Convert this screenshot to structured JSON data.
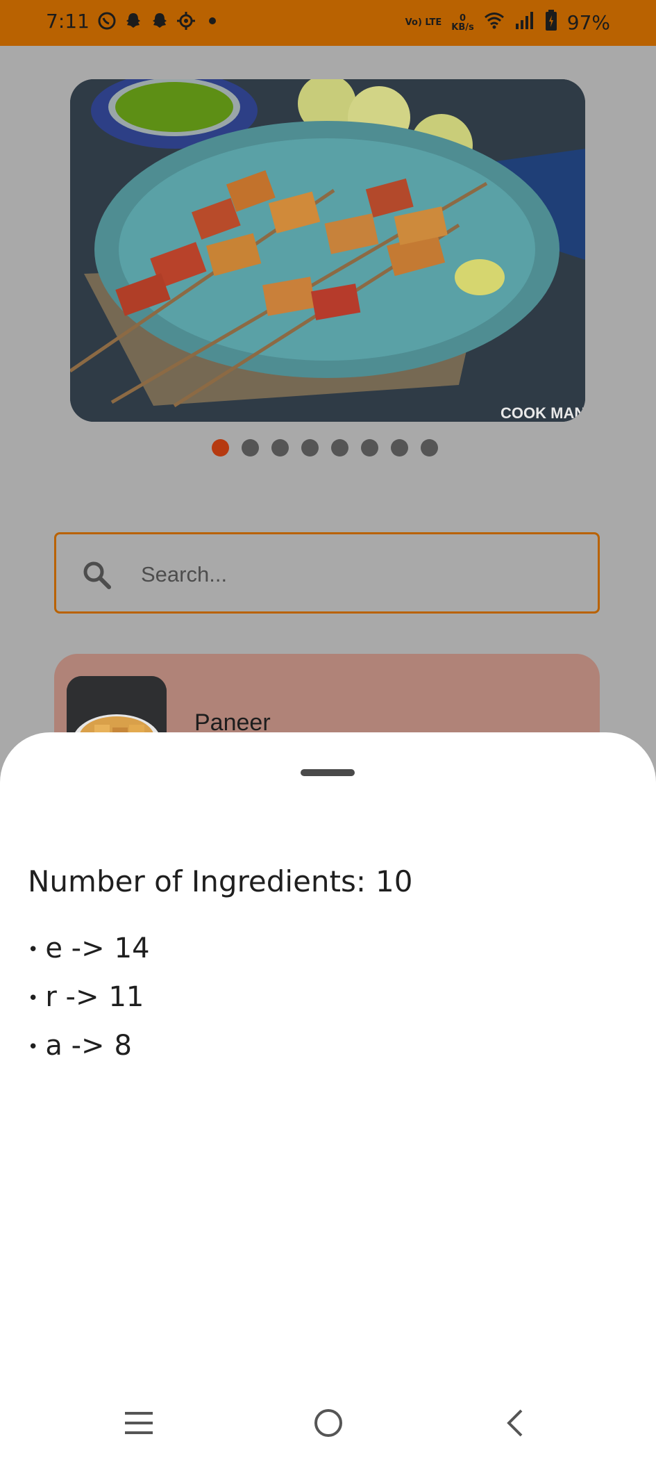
{
  "status_bar": {
    "time": "7:11",
    "icons_left": [
      "whatsapp-icon",
      "snapchat-icon",
      "snapchat-icon",
      "settings-icon",
      "dot-icon"
    ],
    "network_label": "Vo) LTE",
    "speed_value": "0",
    "speed_unit": "KB/s",
    "battery": "97%"
  },
  "carousel": {
    "image_watermark": "COOK MANALI",
    "page_count": 8,
    "active_index": 0
  },
  "search": {
    "placeholder": "Search..."
  },
  "recipe_list": [
    {
      "title": "Paneer"
    }
  ],
  "sheet": {
    "count_label": "Number of Ingredients:",
    "count_value": "10",
    "letter_frequencies": [
      {
        "letter": "e",
        "arrow": "->",
        "count": "14"
      },
      {
        "letter": "r",
        "arrow": "->",
        "count": "11"
      },
      {
        "letter": "a",
        "arrow": "->",
        "count": "8"
      }
    ]
  },
  "nav": {
    "buttons": [
      "menu-icon",
      "home-icon",
      "back-icon"
    ]
  },
  "colors": {
    "accent": "#b96201",
    "active_dot": "#b63a10",
    "card": "#b08378"
  }
}
